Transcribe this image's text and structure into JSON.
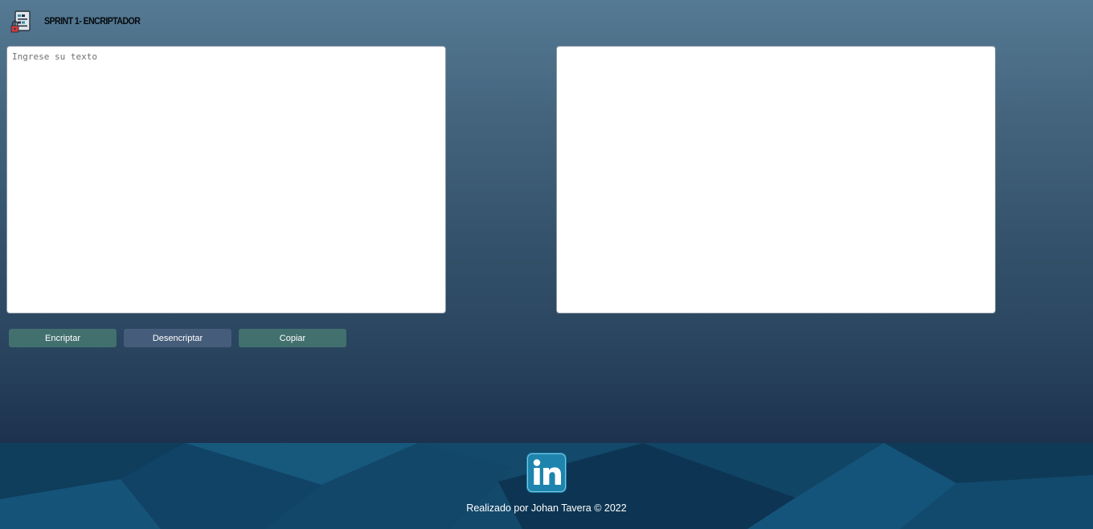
{
  "header": {
    "title": "SPRINT 1- ENCRIPTADOR",
    "logo_icon": "encrypted-document-lock-icon"
  },
  "editor": {
    "input_placeholder": "Ingrese su texto",
    "input_value": "",
    "output_value": ""
  },
  "actions": {
    "encrypt_label": "Encriptar",
    "decrypt_label": "Desencriptar",
    "copy_label": "Copiar"
  },
  "footer": {
    "social_icon": "linkedin-icon",
    "credit": "Realizado por Johan Tavera © 2022"
  },
  "colors": {
    "button_teal": "#41706f",
    "button_slate": "#455d7a",
    "footer_blue": "#13496b",
    "linkedin_blue": "#1e84ad"
  }
}
